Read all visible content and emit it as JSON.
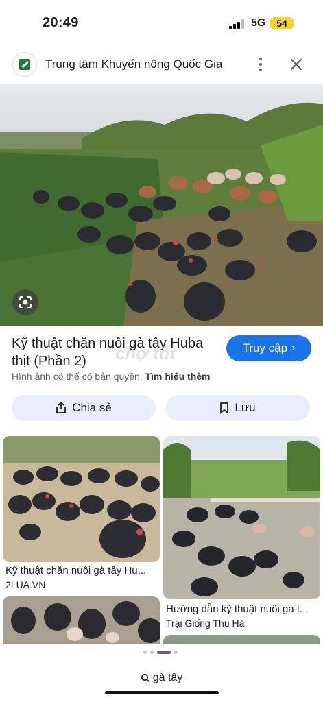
{
  "status_bar": {
    "time": "20:49",
    "network": "5G",
    "battery": "54"
  },
  "header": {
    "site_title": "Trung tâm Khuyến nông Quốc Gia",
    "more_icon": "more-vert-icon",
    "close_icon": "close-icon"
  },
  "hero": {
    "lens_icon": "lens-icon"
  },
  "result": {
    "title": "Kỹ thuật chăn nuôi gà tây Huba thịt (Phần 2)",
    "visit_label": "Truy cập",
    "copyright_text": "Hình ảnh có thể có bản quyền.",
    "learn_more": "Tìm hiểu thêm",
    "watermark": "chợ tốt"
  },
  "actions": {
    "share_label": "Chia sẻ",
    "save_label": "Lưu"
  },
  "related": [
    {
      "title": "Kỹ thuật chăn nuôi gà tây Hu...",
      "source": "2LUA.VN"
    },
    {
      "title": "Hướng dẫn kỹ thuật nuôi gà t...",
      "source": "Trại Giống Thu Hà"
    }
  ],
  "bottom": {
    "query": "gà tây"
  },
  "colors": {
    "accent": "#1a73e8",
    "pill_bg": "#e8eefc",
    "battery": "#f5d22e"
  }
}
